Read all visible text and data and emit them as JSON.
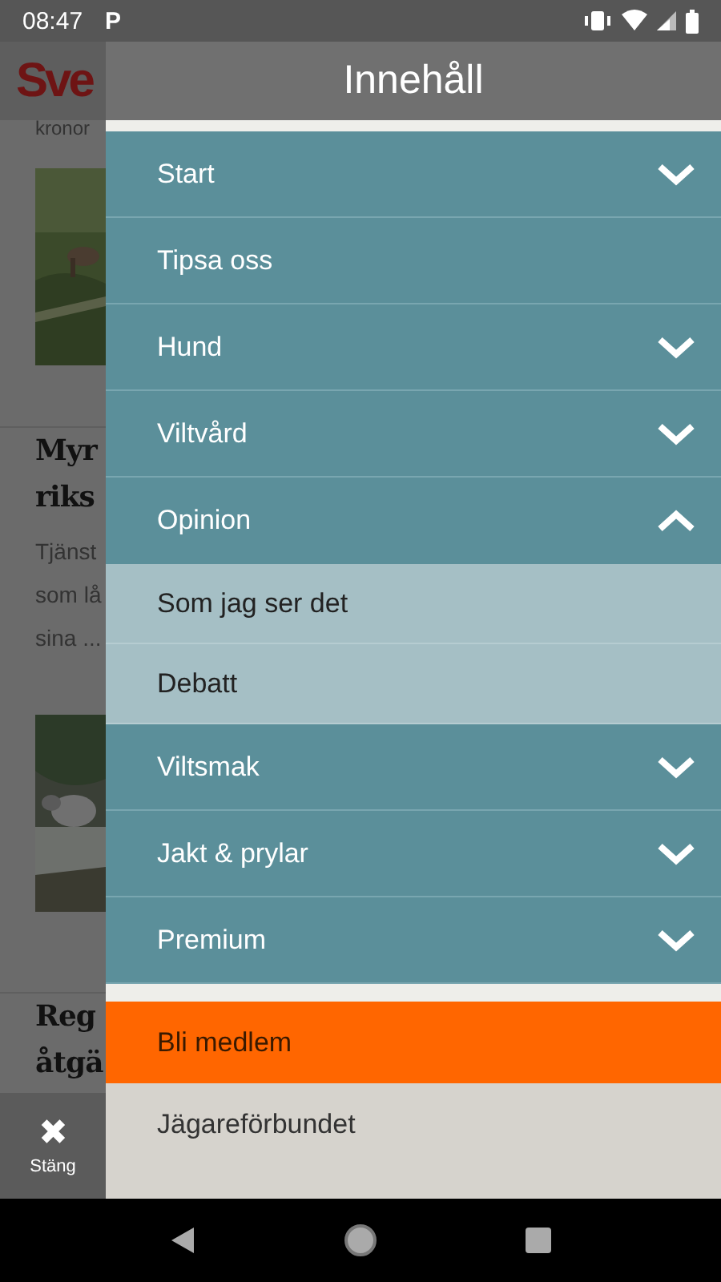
{
  "status_bar": {
    "time": "08:47",
    "app_badge": "P"
  },
  "background": {
    "logo": "Sve",
    "snippet_top": "kronor",
    "headline_1": [
      "Myr",
      "riks"
    ],
    "excerpt_1": [
      "Tjänst",
      "som lå",
      "sina ..."
    ],
    "headline_2": [
      "Reg",
      "åtgä"
    ]
  },
  "close_button": {
    "label": "Stäng",
    "icon": "✖"
  },
  "drawer": {
    "title": "Innehåll",
    "items": [
      {
        "label": "Start",
        "kind": "group",
        "expanded": false
      },
      {
        "label": "Tipsa oss",
        "kind": "link"
      },
      {
        "label": "Hund",
        "kind": "group",
        "expanded": false
      },
      {
        "label": "Viltvård",
        "kind": "group",
        "expanded": false
      },
      {
        "label": "Opinion",
        "kind": "group",
        "expanded": true,
        "children": [
          {
            "label": "Som jag ser det"
          },
          {
            "label": "Debatt"
          }
        ]
      },
      {
        "label": "Viltsmak",
        "kind": "group",
        "expanded": false
      },
      {
        "label": "Jakt & prylar",
        "kind": "group",
        "expanded": false
      },
      {
        "label": "Premium",
        "kind": "group",
        "expanded": false
      }
    ],
    "links": [
      {
        "label": "Bli medlem",
        "kind": "highlight"
      },
      {
        "label": "Jägareförbundet",
        "kind": "plain"
      }
    ]
  }
}
